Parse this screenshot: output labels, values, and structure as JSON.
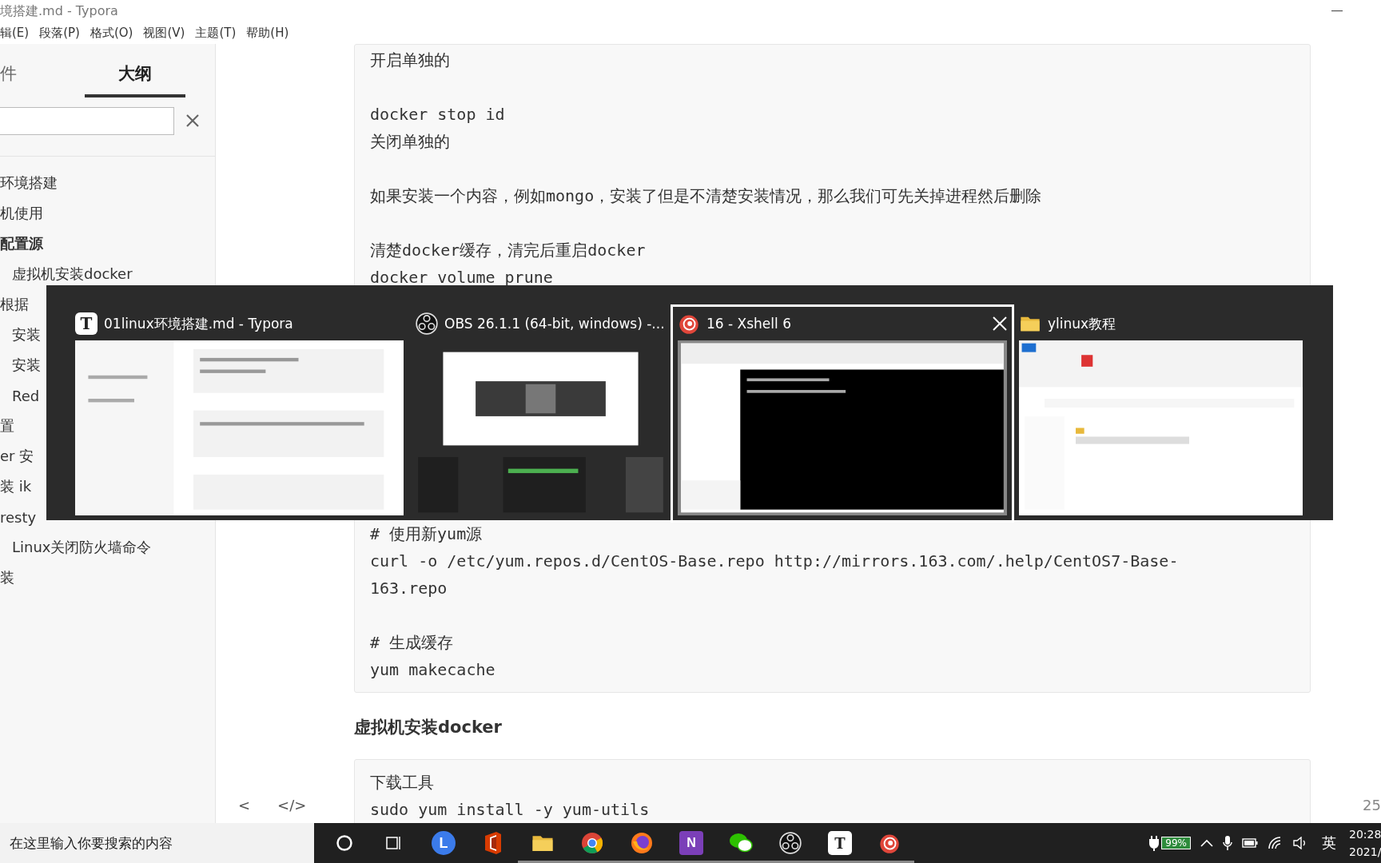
{
  "window": {
    "title": "境搭建.md - Typora"
  },
  "menu": [
    "辑(E)",
    "段落(P)",
    "格式(O)",
    "视图(V)",
    "主题(T)",
    "帮助(H)"
  ],
  "sidebar": {
    "tabs": [
      {
        "label": "件",
        "selected": false
      },
      {
        "label": "大纲",
        "selected": true
      }
    ],
    "outline": [
      {
        "label": "环境搭建",
        "selected": false
      },
      {
        "label": "机使用",
        "selected": false
      },
      {
        "label": "配置源",
        "selected": true,
        "children": [
          {
            "label": "虚拟机安装docker",
            "selected": false
          }
        ]
      },
      {
        "label": "根据",
        "selected": false,
        "children": [
          {
            "label": "安装",
            "selected": false
          },
          {
            "label": "安装",
            "selected": false
          },
          {
            "label": "Red",
            "selected": false
          }
        ]
      },
      {
        "label": "置",
        "selected": false
      },
      {
        "label": "er 安",
        "selected": false
      },
      {
        "label": "装 ik",
        "selected": false
      },
      {
        "label": "resty",
        "selected": false,
        "children": [
          {
            "label": "Linux关闭防火墙命令",
            "selected": false
          }
        ]
      },
      {
        "label": "装",
        "selected": false
      }
    ]
  },
  "document": [
    {
      "kind": "code",
      "groups": [
        [
          "开启单独的"
        ],
        [
          "docker stop id",
          "关闭单独的"
        ],
        [
          "如果安装一个内容，例如mongo，安装了但是不清楚安装情况，那么我们可先关掉进程然后删除"
        ],
        [
          "清楚docker缓存，清完后重启docker",
          "docker volume prune"
        ]
      ]
    },
    {
      "kind": "code",
      "groups": [
        [
          "# 使用新yum源",
          "curl -o /etc/yum.repos.d/CentOS-Base.repo http://mirrors.163.com/.help/CentOS7-Base-",
          "163.repo"
        ],
        [
          "# 生成缓存",
          "yum makecache"
        ]
      ]
    },
    {
      "kind": "heading",
      "text": "虚拟机安装docker"
    },
    {
      "kind": "code",
      "groups": [
        [
          "下载工具",
          "sudo yum install -y yum-utils"
        ]
      ]
    }
  ],
  "editor_footer": {
    "back": "<",
    "source": "</>",
    "word_count": "25"
  },
  "switcher": [
    {
      "kind": "typora",
      "glyph": "T",
      "title": "01linux环境搭建.md - Typora",
      "selected": false
    },
    {
      "kind": "obs",
      "title": "OBS 26.1.1 (64-bit, windows) -...",
      "selected": false
    },
    {
      "kind": "xshell",
      "title": "16 - Xshell 6",
      "selected": true
    },
    {
      "kind": "folder",
      "title": "ylinux教程",
      "selected": false
    }
  ],
  "taskbar": {
    "search": {
      "placeholder": "在这里输入你要搜索的内容"
    },
    "apps": [
      {
        "kind": "cortana",
        "open": false
      },
      {
        "kind": "taskview",
        "open": false
      },
      {
        "kind": "lark",
        "glyph": "L",
        "open": false
      },
      {
        "kind": "office",
        "open": false
      },
      {
        "kind": "explorer",
        "open": true
      },
      {
        "kind": "chrome",
        "open": true
      },
      {
        "kind": "firefox",
        "open": true
      },
      {
        "kind": "onenote",
        "glyph": "N",
        "open": true
      },
      {
        "kind": "wechat",
        "open": true
      },
      {
        "kind": "obs",
        "open": true
      },
      {
        "kind": "typora",
        "glyph": "T",
        "open": true
      },
      {
        "kind": "xshell",
        "open": true
      }
    ],
    "battery": "99%",
    "ime": "英",
    "time": "20:28",
    "date": "2021/"
  }
}
